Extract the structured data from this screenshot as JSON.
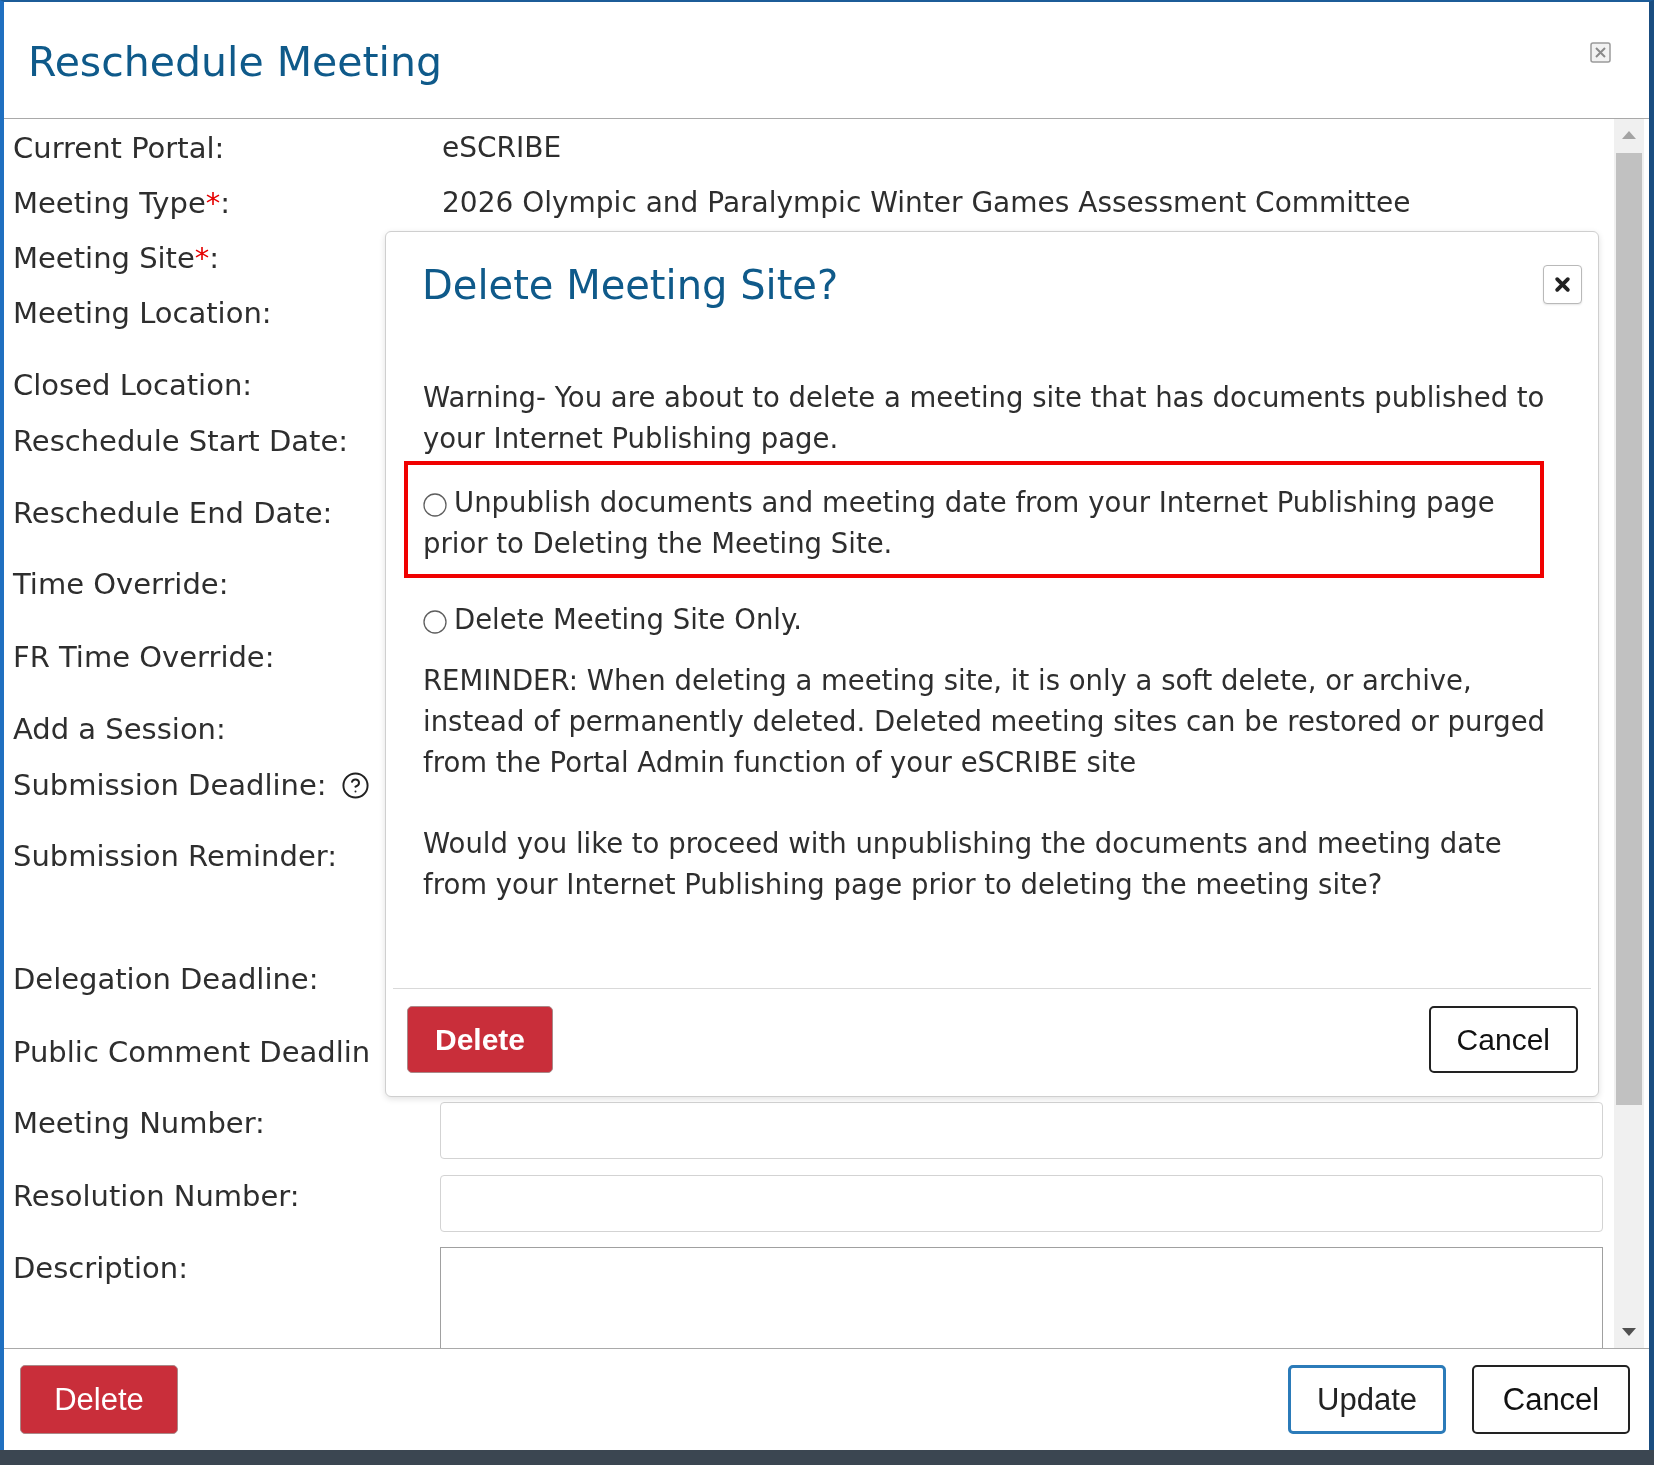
{
  "window": {
    "title": "Reschedule Meeting"
  },
  "form": {
    "rows": [
      {
        "label": "Current Portal:",
        "kind": "text",
        "value": "eSCRIBE",
        "help": false
      },
      {
        "label": "Meeting Type",
        "required_mark": "*",
        "suffix": ":",
        "kind": "text",
        "value": "2026 Olympic and Paralympic Winter Games Assessment Committee",
        "help": false
      },
      {
        "label": "Meeting Site",
        "required_mark": "*",
        "suffix": ":",
        "kind": "none",
        "help": false
      },
      {
        "label": "Meeting Location:",
        "kind": "none",
        "help": false
      },
      {
        "label": "Closed Location:",
        "kind": "none",
        "help": false
      },
      {
        "label": "Reschedule Start Date:",
        "kind": "none",
        "help": false
      },
      {
        "label": "Reschedule End Date:",
        "kind": "none",
        "help": false
      },
      {
        "label": "Time Override:",
        "kind": "none",
        "help": false
      },
      {
        "label": "FR Time Override:",
        "kind": "none",
        "help": false
      },
      {
        "label": "Add a Session:",
        "kind": "none",
        "help": false
      },
      {
        "label": "Submission Deadline:",
        "kind": "none",
        "help": true
      },
      {
        "label": "Submission Reminder:",
        "kind": "none",
        "help": false
      },
      {
        "label": "Delegation Deadline:",
        "kind": "none",
        "help": false
      },
      {
        "label": "Public Comment Deadlin",
        "kind": "none",
        "help": false
      },
      {
        "label": "Meeting Number:",
        "kind": "input",
        "help": false
      },
      {
        "label": "Resolution Number:",
        "kind": "input",
        "help": false
      },
      {
        "label": "Description:",
        "kind": "textarea",
        "help": false
      }
    ]
  },
  "dialog": {
    "title": "Delete Meeting Site?",
    "warning": "Warning- You are about to delete a meeting site that has documents published to your Internet Publishing page.",
    "options": [
      {
        "label": "Unpublish documents and meeting date from your Internet Publishing page prior to Deleting the Meeting Site.",
        "selected": false,
        "highlighted": true
      },
      {
        "label": "Delete Meeting Site Only.",
        "selected": false,
        "highlighted": false
      }
    ],
    "reminder": "REMINDER: When deleting a meeting site, it is only a soft delete, or archive, instead of permanently deleted. Deleted meeting sites can be restored or purged from the Portal Admin function of your eSCRIBE site",
    "question": "Would you like to proceed with unpublishing the documents and meeting date from your Internet Publishing page prior to deleting the meeting site?",
    "buttons": [
      {
        "label": "Delete",
        "kind": "danger"
      },
      {
        "label": "Cancel",
        "kind": "default"
      }
    ]
  },
  "footer": {
    "buttons": [
      {
        "label": "Delete",
        "kind": "danger"
      },
      {
        "label": "Update",
        "kind": "primary"
      },
      {
        "label": "Cancel",
        "kind": "default"
      }
    ]
  }
}
